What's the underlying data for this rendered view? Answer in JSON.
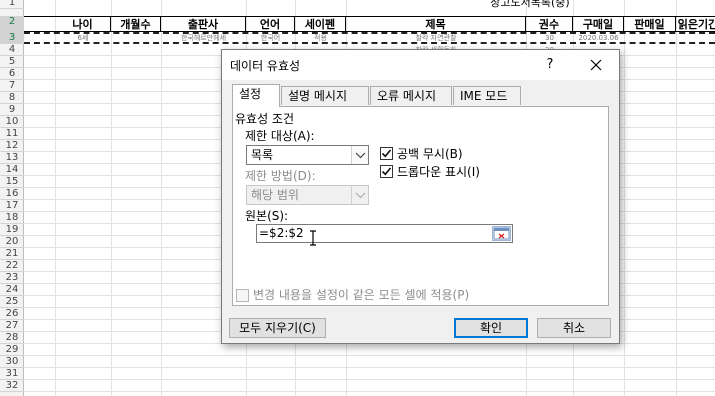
{
  "sheet": {
    "title": "장고도서목록(중)",
    "row_numbers": [
      "1",
      "2",
      "3",
      "4",
      "5",
      "6",
      "7",
      "8",
      "9",
      "10",
      "11",
      "12",
      "13",
      "14",
      "15",
      "16",
      "17",
      "18",
      "19",
      "20",
      "21",
      "22",
      "23",
      "24",
      "25",
      "26",
      "27",
      "28",
      "29",
      "30",
      "31",
      "32"
    ],
    "headers": [
      "나이",
      "개월수",
      "출판사",
      "언어",
      "세이펜",
      "제목",
      "권수",
      "구매일",
      "판매일",
      "읽은기간"
    ],
    "row3": {
      "age": "6세",
      "publisher": "한국헤르만헤세",
      "language": "한국어",
      "saypen": "적용",
      "title": "찰칵 자연관찰",
      "count": "30",
      "purchase_date": "2020.03.06"
    },
    "row4": {
      "title": "찰칵 생활동화",
      "count": "30"
    }
  },
  "dialog": {
    "title": "데이터 유효성",
    "help": "?",
    "tabs": [
      "설정",
      "오류 메시지"
    ],
    "tab_settings": "설정",
    "tab_input_message": "설명 메시지",
    "tab_error_message": "오류 메시지",
    "tab_ime": "IME 모드",
    "group_title": "유효성 조건",
    "allow_label": "제한 대상(A):",
    "allow_value": "목록",
    "ignore_blank_label": "공백 무시(B)",
    "ignore_blank_checked": true,
    "dropdown_label": "드롭다운 표시(I)",
    "dropdown_checked": true,
    "data_label": "제한 방법(D):",
    "data_value": "해당 범위",
    "source_label": "원본(S):",
    "source_value": "=$2:$2",
    "apply_all_label": "변경 내용을 설정이 같은 모든 셀에 적용(P)",
    "apply_all_checked": false,
    "clear_all": "모두 지우기(C)",
    "ok": "확인",
    "cancel": "취소"
  },
  "colors": {
    "accent": "#0078d7",
    "disabled_text": "#8d8d8d",
    "excel_green": "#107c41"
  }
}
